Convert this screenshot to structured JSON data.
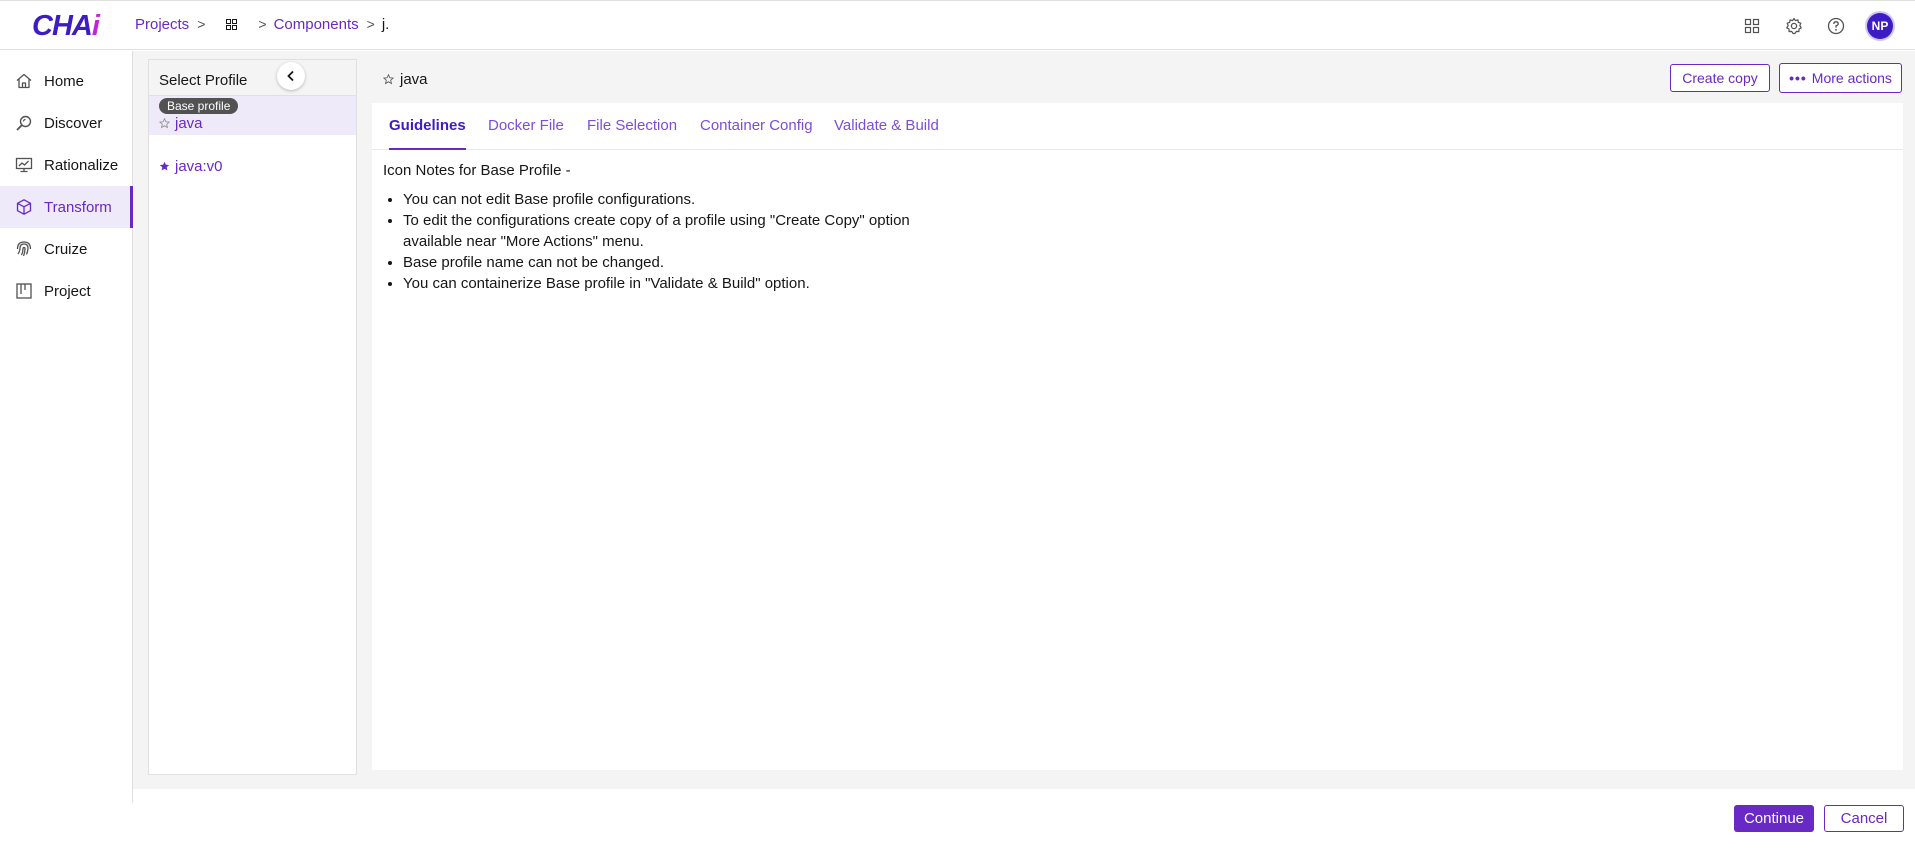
{
  "app": {
    "logo_text_main": "CHA",
    "logo_text_accent": "i"
  },
  "breadcrumb": {
    "items": [
      {
        "label": "Projects"
      },
      {
        "label": "Components"
      }
    ],
    "separator": ">",
    "grid_icon": "grid-icon",
    "current": "j."
  },
  "header_icons": [
    "apps-grid-icon",
    "gear-icon",
    "help-icon"
  ],
  "user": {
    "initials": "NP"
  },
  "sidebar": {
    "items": [
      {
        "label": "Home",
        "icon": "home-icon",
        "active": false
      },
      {
        "label": "Discover",
        "icon": "discover-icon",
        "active": false
      },
      {
        "label": "Rationalize",
        "icon": "rationalize-icon",
        "active": false
      },
      {
        "label": "Transform",
        "icon": "cube-icon",
        "active": true
      },
      {
        "label": "Cruize",
        "icon": "fingerprint-icon",
        "active": false
      },
      {
        "label": "Project",
        "icon": "board-icon",
        "active": false
      }
    ]
  },
  "profile_panel": {
    "title": "Select Profile",
    "profiles": [
      {
        "badge": "Base profile",
        "name": "java",
        "starred": false,
        "selected": true
      },
      {
        "badge": "",
        "name": "java:v0",
        "starred": true,
        "selected": false
      }
    ]
  },
  "detail": {
    "title": "java",
    "create_copy_label": "Create copy",
    "more_actions_label": "More actions",
    "more_actions_dots": "•••",
    "tabs": [
      {
        "label": "Guidelines",
        "active": true
      },
      {
        "label": "Docker File",
        "active": false
      },
      {
        "label": "File Selection",
        "active": false
      },
      {
        "label": "Container Config",
        "active": false
      },
      {
        "label": "Validate & Build",
        "active": false
      }
    ],
    "notes_heading": "Icon Notes for Base Profile -",
    "notes": [
      "You can not edit Base profile configurations.",
      "To edit the configurations create copy of a profile using \"Create Copy\" option available near \"More Actions\" menu.",
      "Base profile name can not be changed.",
      "You can containerize Base profile in \"Validate & Build\" option."
    ]
  },
  "footer": {
    "continue_label": "Continue",
    "cancel_label": "Cancel"
  },
  "colors": {
    "accent": "#6929c4",
    "brand": "#3d1cc4",
    "active_bg": "#eeeaf9",
    "panel_bg": "#f4f4f4"
  }
}
